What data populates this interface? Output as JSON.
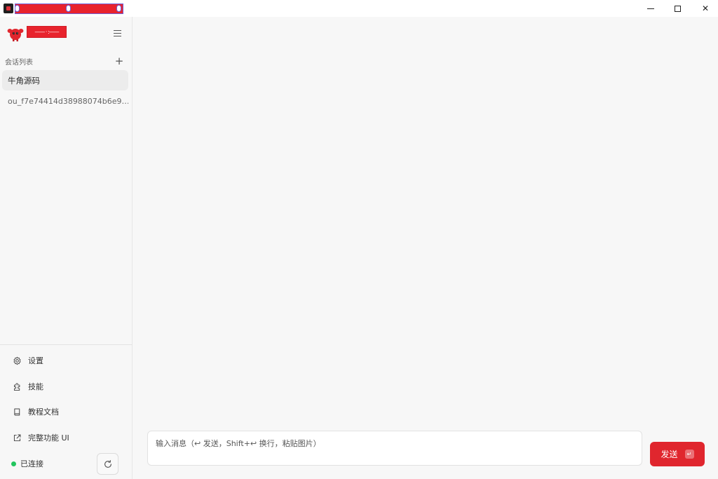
{
  "window": {
    "controls": {
      "minimize_icon": "minimize-icon",
      "maximize_icon": "maximize-icon",
      "close_glyph": "✕"
    }
  },
  "sidebar": {
    "brand_text": "—— · :——",
    "section_title": "会话列表",
    "add_glyph": "+",
    "conversations": [
      {
        "title": "牛角源码",
        "active": true
      },
      {
        "title": "ou_f7e74414d38988074b6e9…",
        "active": false
      }
    ],
    "nav": [
      {
        "label": "设置",
        "icon": "gear-icon"
      },
      {
        "label": "技能",
        "icon": "puzzle-icon"
      },
      {
        "label": "教程文档",
        "icon": "book-icon"
      },
      {
        "label": "完整功能 UI",
        "icon": "external-link-icon"
      }
    ],
    "status": {
      "label": "已连接",
      "color": "#22c55e"
    }
  },
  "composer": {
    "placeholder": "输入消息（↩ 发送，Shift+↩ 换行，粘贴图片）",
    "value": "",
    "send_label": "发送",
    "send_key_glyph": "↵"
  },
  "colors": {
    "accent": "#e0262e",
    "background": "#f7f7f7"
  }
}
